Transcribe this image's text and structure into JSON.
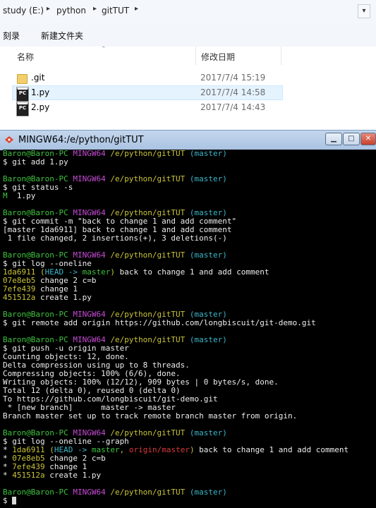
{
  "explorer": {
    "breadcrumbs": [
      "study (E:)",
      "python",
      "gitTUT"
    ],
    "toolbar": {
      "record": "刻录",
      "new_folder": "新建文件夹"
    },
    "columns": {
      "name": "名称",
      "modified": "修改日期"
    },
    "files": [
      {
        "name": ".git",
        "date": "2017/7/4 15:19",
        "icon": "folder-icon",
        "selected": false
      },
      {
        "name": "1.py",
        "date": "2017/7/4 14:58",
        "icon": "python-file-icon",
        "selected": true
      },
      {
        "name": "2.py",
        "date": "2017/7/4 14:43",
        "icon": "python-file-icon",
        "selected": false
      }
    ]
  },
  "terminal": {
    "title": "MINGW64:/e/python/gitTUT",
    "prompt": {
      "user": "Baron@Baron-PC",
      "env": "MINGW64",
      "path": "/e/python/gitTUT",
      "branch": "(master)"
    },
    "blocks": [
      {
        "cmd": "$ git add 1.py",
        "output": []
      },
      {
        "cmd": "$ git status -s",
        "output": [
          [
            {
              "t": "M",
              "c": "green"
            },
            {
              "t": "  1.py",
              "c": "white"
            }
          ]
        ]
      },
      {
        "cmd": "$ git commit -m \"back to change 1 and add comment\"",
        "output": [
          [
            {
              "t": "[master 1da6911] back to change 1 and add comment",
              "c": "white"
            }
          ],
          [
            {
              "t": " 1 file changed, 2 insertions(+), 3 deletions(-)",
              "c": "white"
            }
          ]
        ]
      },
      {
        "cmd": "$ git log --oneline",
        "output": [
          [
            {
              "t": "1da6911",
              "c": "yellow"
            },
            {
              "t": " (",
              "c": "yellow"
            },
            {
              "t": "HEAD -> ",
              "c": "cyan"
            },
            {
              "t": "master",
              "c": "green"
            },
            {
              "t": ")",
              "c": "yellow"
            },
            {
              "t": " back to change 1 and add comment",
              "c": "white"
            }
          ],
          [
            {
              "t": "07e8eb5",
              "c": "yellow"
            },
            {
              "t": " change 2 c=b",
              "c": "white"
            }
          ],
          [
            {
              "t": "7efe439",
              "c": "yellow"
            },
            {
              "t": " change 1",
              "c": "white"
            }
          ],
          [
            {
              "t": "451512a",
              "c": "yellow"
            },
            {
              "t": " create 1.py",
              "c": "white"
            }
          ]
        ]
      },
      {
        "cmd": "$ git remote add origin https://github.com/longbiscuit/git-demo.git",
        "output": []
      },
      {
        "cmd": "$ git push -u origin master",
        "output": [
          [
            {
              "t": "Counting objects: 12, done.",
              "c": "white"
            }
          ],
          [
            {
              "t": "Delta compression using up to 8 threads.",
              "c": "white"
            }
          ],
          [
            {
              "t": "Compressing objects: 100% (6/6), done.",
              "c": "white"
            }
          ],
          [
            {
              "t": "Writing objects: 100% (12/12), 909 bytes | 0 bytes/s, done.",
              "c": "white"
            }
          ],
          [
            {
              "t": "Total 12 (delta 0), reused 0 (delta 0)",
              "c": "white"
            }
          ],
          [
            {
              "t": "To https://github.com/longbiscuit/git-demo.git",
              "c": "white"
            }
          ],
          [
            {
              "t": " * [new branch]      master -> master",
              "c": "white"
            }
          ],
          [
            {
              "t": "Branch master set up to track remote branch master from origin.",
              "c": "white"
            }
          ]
        ]
      },
      {
        "cmd": "$ git log --oneline --graph",
        "output": [
          [
            {
              "t": "* ",
              "c": "white"
            },
            {
              "t": "1da6911",
              "c": "yellow"
            },
            {
              "t": " (",
              "c": "yellow"
            },
            {
              "t": "HEAD -> ",
              "c": "cyan"
            },
            {
              "t": "master",
              "c": "green"
            },
            {
              "t": ", ",
              "c": "yellow"
            },
            {
              "t": "origin/master",
              "c": "red"
            },
            {
              "t": ")",
              "c": "yellow"
            },
            {
              "t": " back to change 1 and add comment",
              "c": "white"
            }
          ],
          [
            {
              "t": "* ",
              "c": "white"
            },
            {
              "t": "07e8eb5",
              "c": "yellow"
            },
            {
              "t": " change 2 c=b",
              "c": "white"
            }
          ],
          [
            {
              "t": "* ",
              "c": "white"
            },
            {
              "t": "7efe439",
              "c": "yellow"
            },
            {
              "t": " change 1",
              "c": "white"
            }
          ],
          [
            {
              "t": "* ",
              "c": "white"
            },
            {
              "t": "451512a",
              "c": "yellow"
            },
            {
              "t": " create 1.py",
              "c": "white"
            }
          ]
        ]
      }
    ],
    "final_prompt": "$ "
  },
  "colors": {
    "prompt_user": "#3ec33e",
    "prompt_env": "#c64bd3",
    "prompt_path": "#c9c33a",
    "prompt_branch": "#3ab6c8",
    "hash": "#c9c33a",
    "remote_branch": "#d93a3a"
  }
}
